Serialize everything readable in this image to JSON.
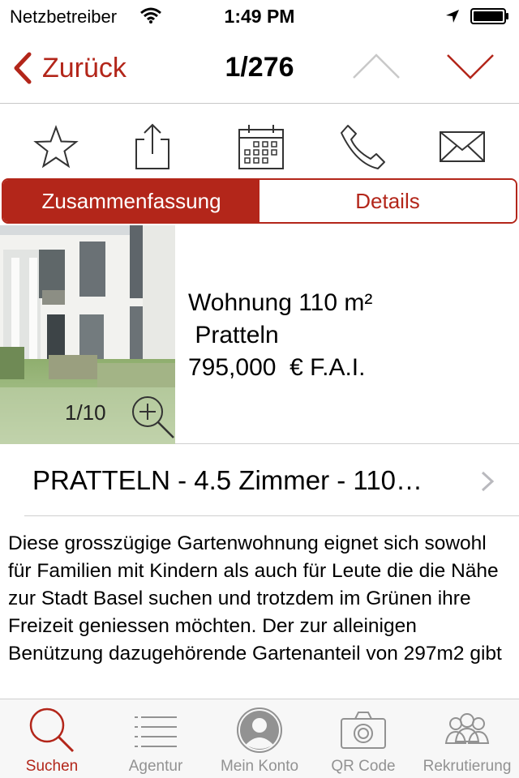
{
  "status_bar": {
    "carrier": "Netzbetreiber",
    "time": "1:49 PM",
    "icons": [
      "wifi-icon",
      "location-arrow-icon",
      "battery-icon"
    ]
  },
  "nav": {
    "back_label": "Zurück",
    "title": "1/276",
    "icons": [
      "chevron-left-icon",
      "chevron-up-icon",
      "chevron-down-icon"
    ]
  },
  "actions": [
    {
      "name": "favorite",
      "icon": "star-icon"
    },
    {
      "name": "share",
      "icon": "share-icon"
    },
    {
      "name": "calendar",
      "icon": "calendar-icon"
    },
    {
      "name": "call",
      "icon": "phone-icon"
    },
    {
      "name": "email",
      "icon": "mail-icon"
    }
  ],
  "segments": [
    {
      "label": "Zusammenfassung",
      "active": true
    },
    {
      "label": "Details",
      "active": false
    }
  ],
  "listing": {
    "photo_counter": "1/10",
    "type_area": "Wohnung 110 m²",
    "city": " Pratteln",
    "price": "795,000  € F.A.I.",
    "headline": "PRATTELN - 4.5 Zimmer - 110…",
    "description": "Diese grosszügige Gartenwohnung eignet sich sowohl für Familien mit Kindern als auch für Leute die die Nähe zur Stadt Basel suchen und trotzdem im Grünen ihre Freizeit geniessen möchten. Der zur alleinigen Benützung dazugehörende Gartenanteil von 297m2 gibt"
  },
  "tabs": [
    {
      "label": "Suchen",
      "icon": "search-icon",
      "active": true
    },
    {
      "label": "Agentur",
      "icon": "list-icon",
      "active": false
    },
    {
      "label": "Mein Konto",
      "icon": "user-avatar-icon",
      "active": false
    },
    {
      "label": "QR Code",
      "icon": "camera-icon",
      "active": false
    },
    {
      "label": "Rekrutierung",
      "icon": "people-icon",
      "active": false
    }
  ],
  "colors": {
    "accent": "#b3261a",
    "tab_inactive": "#929292",
    "tab_bar_bg": "#f7f7f7",
    "divider": "#d0d0d0"
  }
}
